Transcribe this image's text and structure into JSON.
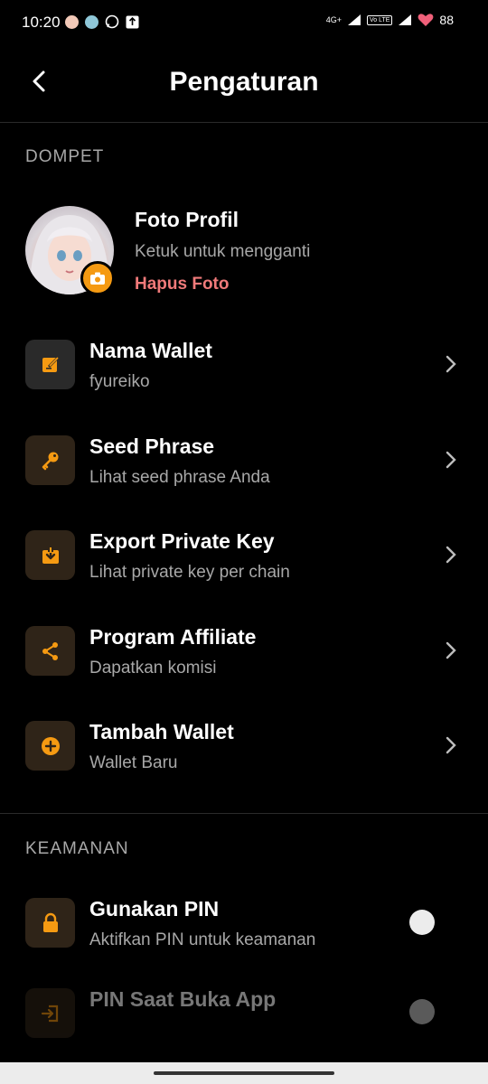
{
  "status_bar": {
    "time": "10:20",
    "network": "4G+",
    "volte": "Vo LTE",
    "battery": "88"
  },
  "header": {
    "title": "Pengaturan"
  },
  "sections": {
    "wallet_label": "DOMPET",
    "security_label": "KEAMANAN"
  },
  "profile": {
    "title": "Foto Profil",
    "subtitle": "Ketuk untuk mengganti",
    "delete_label": "Hapus Foto"
  },
  "rows": [
    {
      "title": "Nama Wallet",
      "subtitle": "fyureiko",
      "icon": "edit-icon"
    },
    {
      "title": "Seed Phrase",
      "subtitle": "Lihat seed phrase Anda",
      "icon": "key-icon"
    },
    {
      "title": "Export Private Key",
      "subtitle": "Lihat private key per chain",
      "icon": "download-icon"
    },
    {
      "title": "Program Affiliate",
      "subtitle": "Dapatkan komisi",
      "icon": "share-icon"
    },
    {
      "title": "Tambah Wallet",
      "subtitle": "Wallet Baru",
      "icon": "plus-circle-icon"
    }
  ],
  "security": {
    "pin": {
      "title": "Gunakan PIN",
      "subtitle": "Aktifkan PIN untuk keamanan",
      "enabled": false
    },
    "pin_on_open": {
      "title": "PIN Saat Buka App",
      "enabled": false,
      "disabled": true
    }
  },
  "colors": {
    "accent": "#f59a12",
    "danger": "#f07a7a",
    "background": "#000000",
    "muted_text": "#a8a8a8"
  }
}
